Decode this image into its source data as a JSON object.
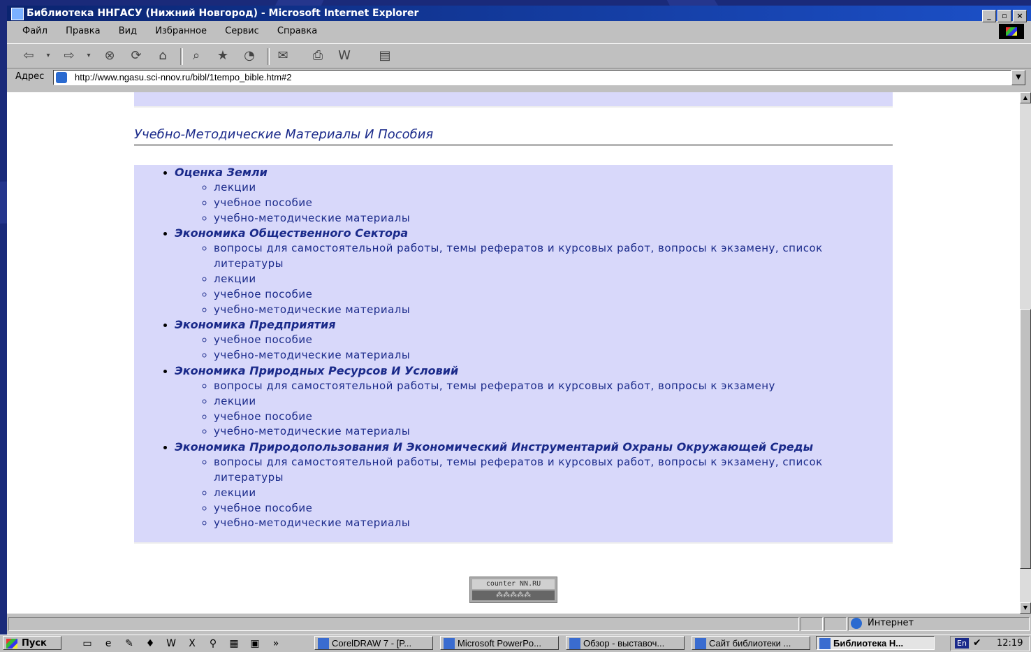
{
  "window": {
    "title": "Библиотека ННГАСУ (Нижний Новгород) - Microsoft Internet Explorer",
    "min": "_",
    "max": "▫",
    "close": "×"
  },
  "menu": [
    "Файл",
    "Правка",
    "Вид",
    "Избранное",
    "Сервис",
    "Справка"
  ],
  "address": {
    "label": "Адрес",
    "url": "http://www.ngasu.sci-nnov.ru/bibl/1tempo_bible.htm#2"
  },
  "page": {
    "section_title": "Учебно-Методические Материалы И Пособия",
    "categories": [
      {
        "name": "Оценка Земли",
        "items": [
          "лекции",
          "учебное пособие",
          "учебно-методические материалы"
        ]
      },
      {
        "name": "Экономика Общественного Сектора",
        "items": [
          "вопросы для самостоятельной работы, темы рефератов и курсовых работ, вопросы к экзамену, список литературы",
          "лекции",
          "учебное пособие",
          "учебно-методические материалы"
        ]
      },
      {
        "name": "Экономика Предприятия",
        "items": [
          "учебное пособие",
          "учебно-методические материалы"
        ]
      },
      {
        "name": "Экономика Природных Ресурсов И Условий",
        "items": [
          "вопросы для самостоятельной работы, темы рефератов и курсовых работ, вопросы к экзамену",
          "лекции",
          "учебное пособие",
          "учебно-методические материалы"
        ]
      },
      {
        "name": "Экономика Природопользования И Экономический Инструментарий Охраны Окружающей Среды",
        "items": [
          "вопросы для самостоятельной работы, темы рефератов и курсовых работ, вопросы к экзамену, список литературы",
          "лекции",
          "учебное пособие",
          "учебно-методические материалы"
        ]
      }
    ],
    "counter": {
      "line1": "counter NN.RU",
      "line2": "⁂⁂⁂⁂⁂"
    }
  },
  "status": {
    "zone": "Интернет"
  },
  "taskbar": {
    "start": "Пуск",
    "more": "»",
    "tasks": [
      "CorelDRAW 7 - [P...",
      "Microsoft PowerPo...",
      "Обзор - выставоч...",
      "Сайт библиотеки ...",
      "Библиотека Н..."
    ],
    "lang": "En",
    "clock": "12:19"
  }
}
